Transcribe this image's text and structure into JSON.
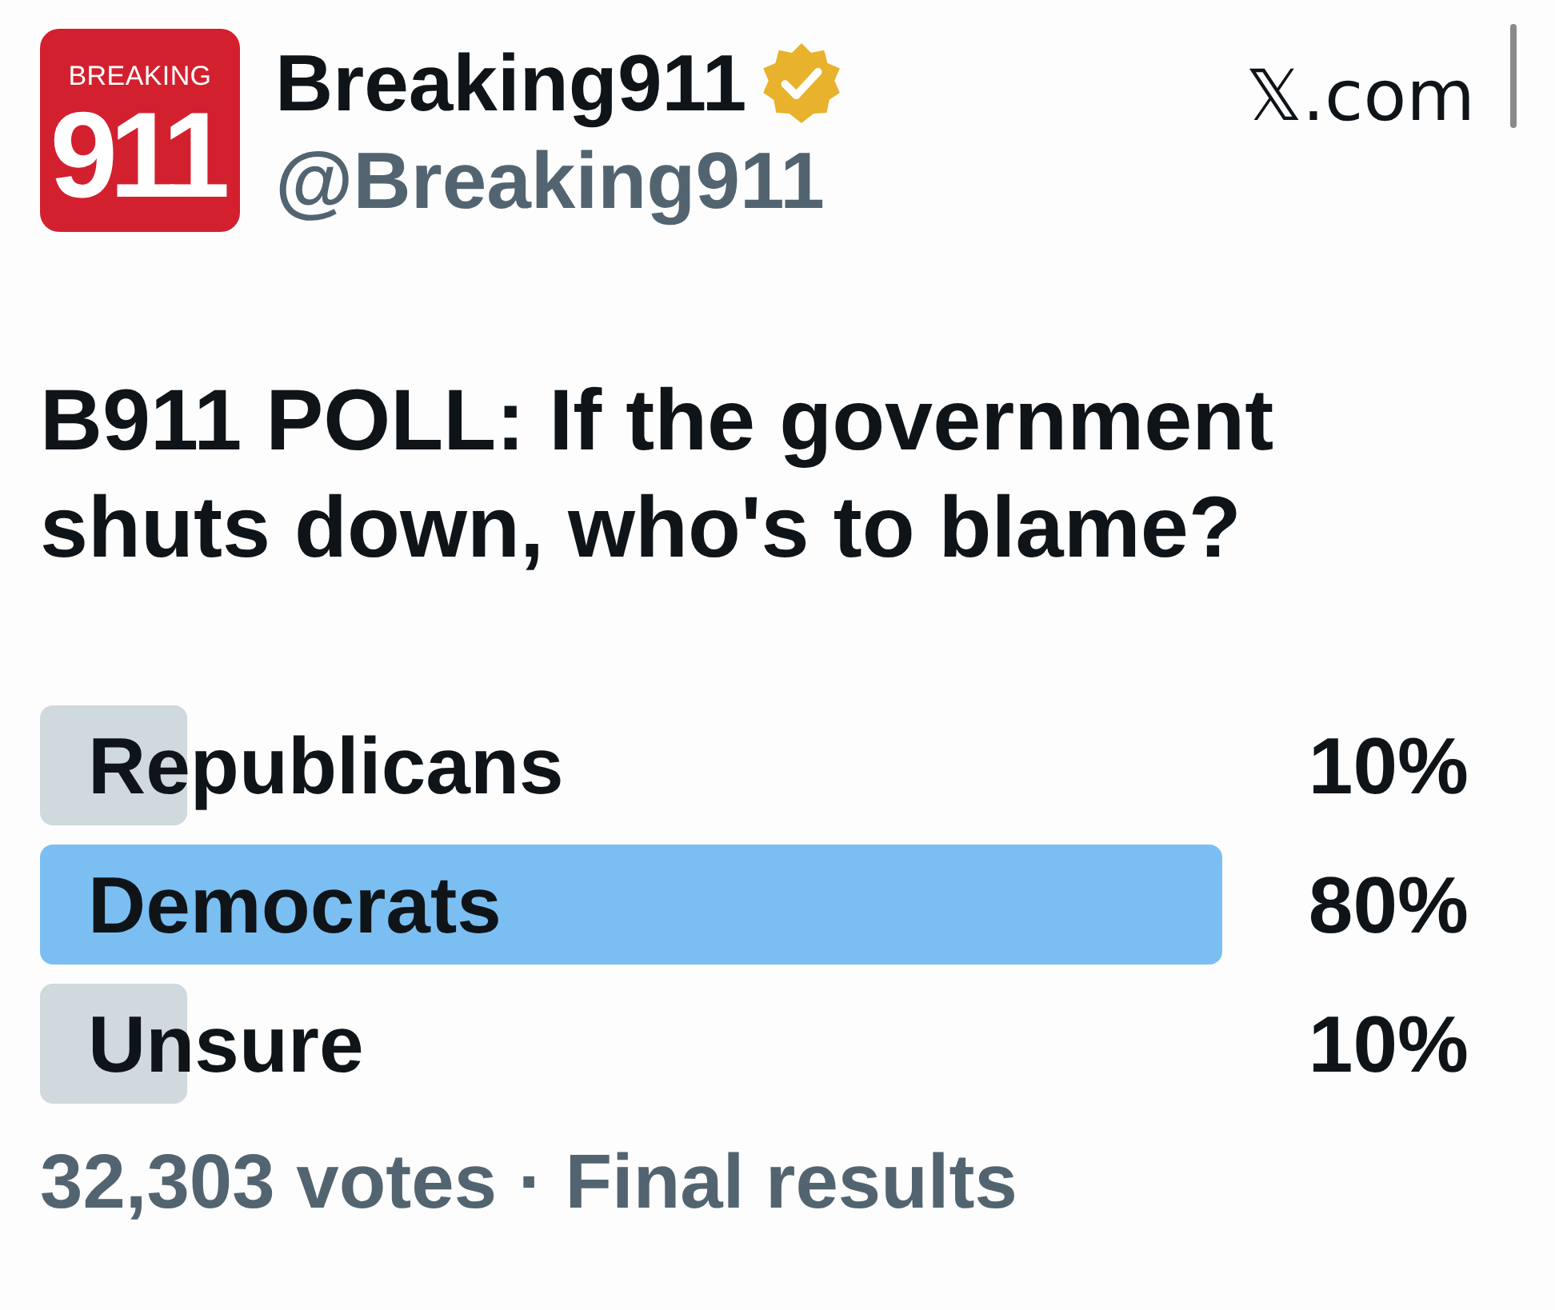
{
  "header": {
    "avatar": {
      "top_text": "BREAKING",
      "main_text": "911"
    },
    "display_name": "Breaking911",
    "verified": true,
    "handle": "@Breaking911",
    "site": "𝕏.com"
  },
  "poll": {
    "question": "B911 POLL: If the government shuts down, who's to blame?",
    "options": [
      {
        "label": "Republicans",
        "percent": "10%",
        "level": 0.1,
        "winner": false
      },
      {
        "label": "Democrats",
        "percent": "80%",
        "level": 0.8,
        "winner": true
      },
      {
        "label": "Unsure",
        "percent": "10%",
        "level": 0.1,
        "winner": false
      }
    ],
    "footer": "32,303 votes · Final results"
  }
}
